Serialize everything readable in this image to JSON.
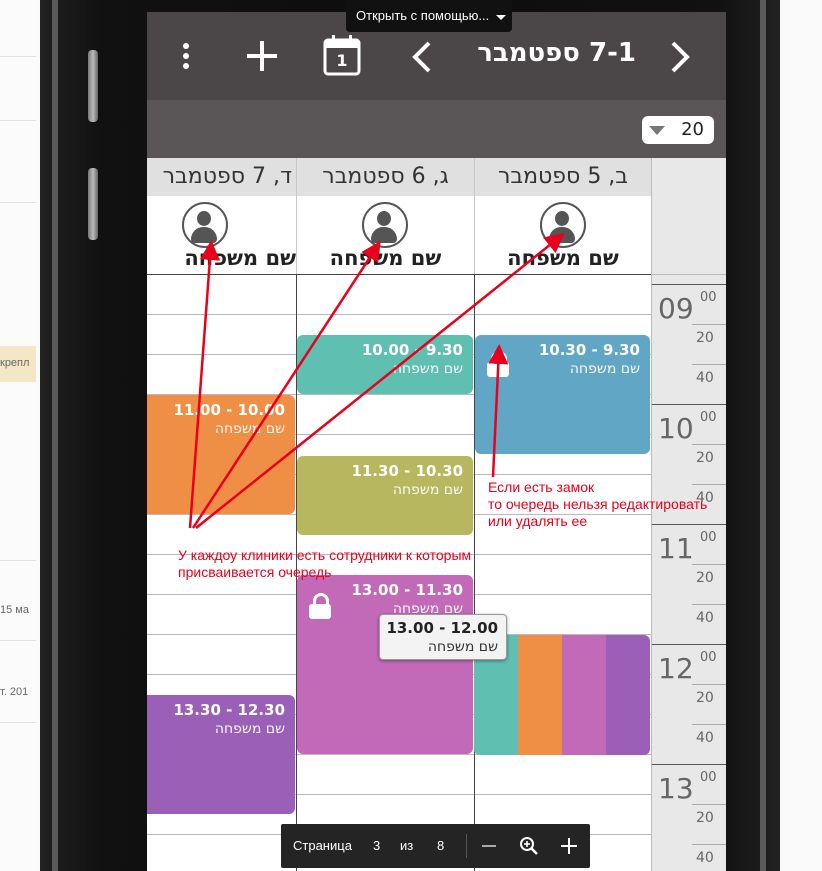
{
  "viewer": {
    "open_with_label": "Открыть с помощью...",
    "pager": {
      "page_label": "Страница",
      "page": "3",
      "of_label": "из",
      "total": "8",
      "zoom_out_icon": "minus-icon",
      "zoom_icon": "magnifier-icon",
      "zoom_in_icon": "plus-icon"
    }
  },
  "background": {
    "date_fragment_1": "15 ма",
    "date_fragment_2": "т. 201",
    "highlight_fragment": "крепл"
  },
  "app": {
    "toolbar": {
      "week_title": "7-1 ספטמבר",
      "icons": [
        "more-vertical-icon",
        "plus-icon",
        "calendar-icon",
        "chevron-left-icon",
        "chevron-right-icon"
      ],
      "calendar_icon_day": "1"
    },
    "zoom": {
      "value": "20"
    },
    "days": [
      {
        "label": "ב, 5 ספטמבר"
      },
      {
        "label": "ג, 6 ספטמבר"
      },
      {
        "label": "ד, 7 ספטמבר"
      }
    ],
    "staff": [
      {
        "name": "שם משפחה"
      },
      {
        "name": "שם משפחה"
      },
      {
        "name": "שם משפחה"
      }
    ],
    "time_axis": {
      "hours": [
        "09",
        "10",
        "11",
        "12",
        "13"
      ],
      "sup": "00",
      "minutes": [
        "20",
        "40"
      ]
    },
    "appointments": [
      {
        "time": "10.00 - 9.30",
        "name": "שם משפחה",
        "color": "#5fbfb0",
        "locked": false
      },
      {
        "time": "10.30 - 9.30",
        "name": "שם משפחה",
        "color": "#62a6c6",
        "locked": true
      },
      {
        "time": "11.00 - 10.00",
        "name": "שם משפחה",
        "color": "#ef8f45",
        "locked": false
      },
      {
        "time": "11.30 - 10.30",
        "name": "שם משפחה",
        "color": "#b7b75f",
        "locked": false
      },
      {
        "time": "13.00 - 11.30",
        "name": "שם משפחה",
        "color": "#c269b8",
        "locked": true
      },
      {
        "time": "13.30 - 12.30",
        "name": "שם משפחה",
        "color": "#9a5fb7",
        "locked": false
      }
    ],
    "tooltip": {
      "time": "13.00 - 12.00",
      "name": "שם משפחה"
    },
    "strips": [
      "#5fbfb0",
      "#ef8f45",
      "#c269b8",
      "#9a5fb7"
    ]
  },
  "annotations": {
    "lock_note": [
      "Если есть замок",
      "то очередь нельзя редактировать",
      "или удалять ее"
    ],
    "staff_note": [
      "У каждоу клиники есть сотрудники к которым",
      "присваивается очередь"
    ],
    "color": "#e8001c"
  }
}
